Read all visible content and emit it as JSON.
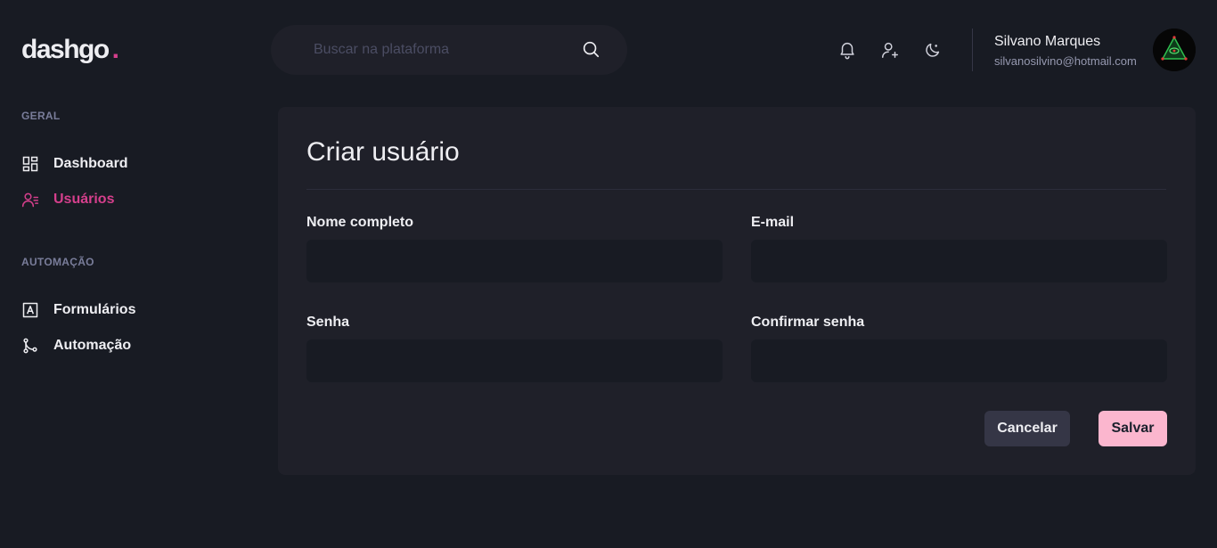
{
  "brand": {
    "name": "dashgo",
    "dot": ".",
    "accent_color": "#d53f8c"
  },
  "search": {
    "placeholder": "Buscar na plataforma",
    "value": "",
    "icon": "search-icon"
  },
  "header": {
    "icons": [
      "bell-icon",
      "user-add-icon",
      "moon-icon"
    ],
    "user": {
      "name": "Silvano Marques",
      "email": "silvanosilvino@hotmail.com"
    }
  },
  "sidebar": {
    "sections": [
      {
        "title": "GERAL",
        "items": [
          {
            "label": "Dashboard",
            "icon": "dashboard-icon",
            "active": false
          },
          {
            "label": "Usuários",
            "icon": "users-icon",
            "active": true
          }
        ]
      },
      {
        "title": "AUTOMAÇÃO",
        "items": [
          {
            "label": "Formulários",
            "icon": "form-icon",
            "active": false
          },
          {
            "label": "Automação",
            "icon": "git-merge-icon",
            "active": false
          }
        ]
      }
    ]
  },
  "form": {
    "title": "Criar usuário",
    "fields": {
      "name": {
        "label": "Nome completo",
        "value": ""
      },
      "email": {
        "label": "E-mail",
        "value": ""
      },
      "password": {
        "label": "Senha",
        "value": ""
      },
      "password_confirmation": {
        "label": "Confirmar senha",
        "value": ""
      }
    },
    "actions": {
      "cancel": "Cancelar",
      "save": "Salvar"
    }
  },
  "colors": {
    "background": "#181b23",
    "card": "#1f2029",
    "text": "#eeeef2",
    "muted": "#797d9a",
    "save_button": "#fbb6ce",
    "cancel_button": "#353646"
  }
}
